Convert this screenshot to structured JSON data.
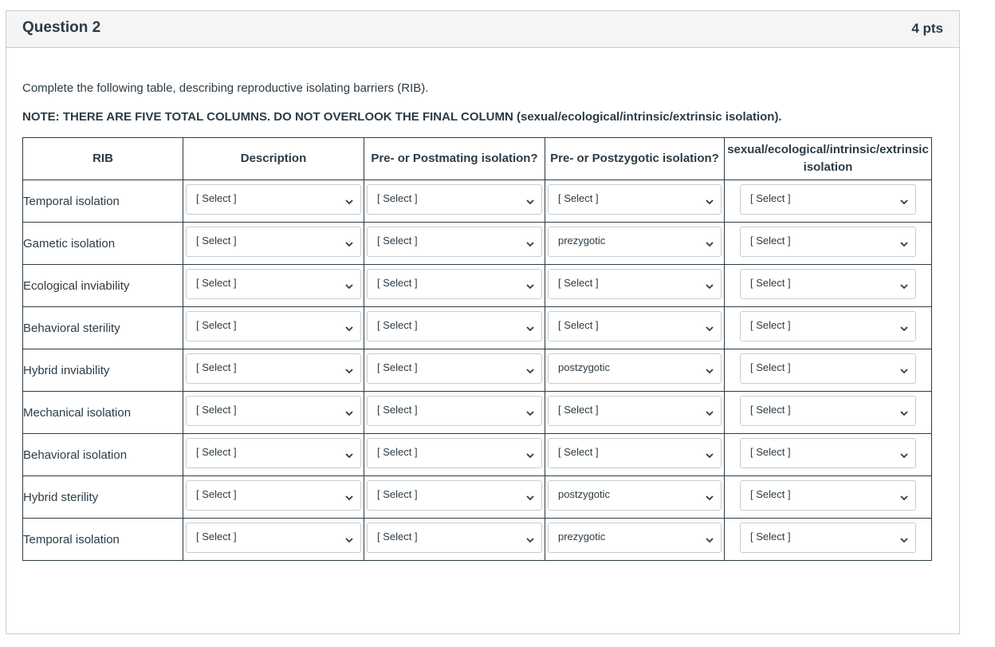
{
  "question": {
    "title": "Question 2",
    "points": "4 pts",
    "text": "Complete the following table, describing reproductive isolating barriers (RIB).",
    "note": "NOTE: THERE ARE FIVE TOTAL COLUMNS. DO NOT OVERLOOK THE FINAL COLUMN (sexual/ecological/intrinsic/extrinsic isolation)."
  },
  "table": {
    "headers": [
      "RIB",
      "Description",
      "Pre- or Postmating isolation?",
      "Pre- or Postzygotic isolation?",
      "sexual/ecological/intrinsic/extrinsic isolation"
    ],
    "rows": [
      {
        "rib": "Temporal isolation",
        "description": "[ Select ]",
        "mating": "[ Select ]",
        "zygotic": "[ Select ]",
        "category": "[ Select ]"
      },
      {
        "rib": "Gametic isolation",
        "description": "[ Select ]",
        "mating": "[ Select ]",
        "zygotic": "prezygotic",
        "category": "[ Select ]"
      },
      {
        "rib": "Ecological inviability",
        "description": "[ Select ]",
        "mating": "[ Select ]",
        "zygotic": "[ Select ]",
        "category": "[ Select ]"
      },
      {
        "rib": "Behavioral sterility",
        "description": "[ Select ]",
        "mating": "[ Select ]",
        "zygotic": "[ Select ]",
        "category": "[ Select ]"
      },
      {
        "rib": "Hybrid inviability",
        "description": "[ Select ]",
        "mating": "[ Select ]",
        "zygotic": "postzygotic",
        "category": "[ Select ]"
      },
      {
        "rib": "Mechanical isolation",
        "description": "[ Select ]",
        "mating": "[ Select ]",
        "zygotic": "[ Select ]",
        "category": "[ Select ]"
      },
      {
        "rib": "Behavioral isolation",
        "description": "[ Select ]",
        "mating": "[ Select ]",
        "zygotic": "[ Select ]",
        "category": "[ Select ]"
      },
      {
        "rib": "Hybrid sterility",
        "description": "[ Select ]",
        "mating": "[ Select ]",
        "zygotic": "postzygotic",
        "category": "[ Select ]"
      },
      {
        "rib": "Temporal isolation",
        "description": "[ Select ]",
        "mating": "[ Select ]",
        "zygotic": "prezygotic",
        "category": "[ Select ]"
      }
    ]
  }
}
